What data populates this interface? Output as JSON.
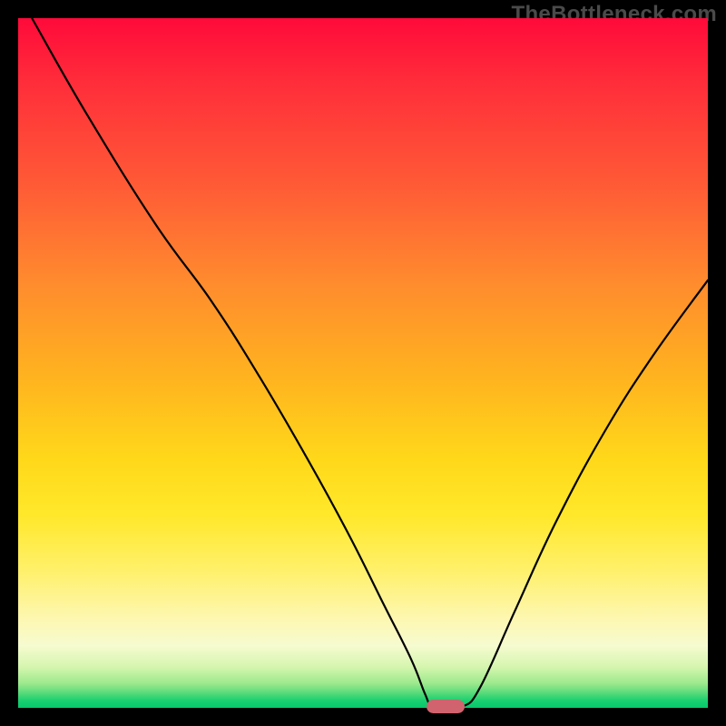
{
  "watermark": "TheBottleneck.com",
  "chart_data": {
    "type": "line",
    "title": "",
    "xlabel": "",
    "ylabel": "",
    "xlim": [
      0,
      100
    ],
    "ylim": [
      0,
      100
    ],
    "grid": false,
    "legend": false,
    "annotations": [],
    "series": [
      {
        "name": "bottleneck-curve",
        "x": [
          2,
          10,
          20,
          28,
          35,
          42,
          48,
          53,
          57,
          59,
          60,
          62,
          64.5,
          67,
          72,
          78,
          85,
          92,
          100
        ],
        "values": [
          100,
          86,
          70,
          59,
          48,
          36,
          25,
          15,
          7,
          2,
          0.2,
          0.2,
          0.2,
          3,
          14,
          27,
          40,
          51,
          62
        ]
      }
    ],
    "background_gradient": {
      "orientation": "vertical",
      "stops": [
        {
          "pos": 0.0,
          "color": "#ff0a3a"
        },
        {
          "pos": 0.24,
          "color": "#ff5a36"
        },
        {
          "pos": 0.52,
          "color": "#ffb31f"
        },
        {
          "pos": 0.8,
          "color": "#fff06a"
        },
        {
          "pos": 0.94,
          "color": "#d6f6b0"
        },
        {
          "pos": 1.0,
          "color": "#07c86c"
        }
      ]
    },
    "marker": {
      "x": 62,
      "y": 0,
      "color": "#d1636f"
    }
  }
}
